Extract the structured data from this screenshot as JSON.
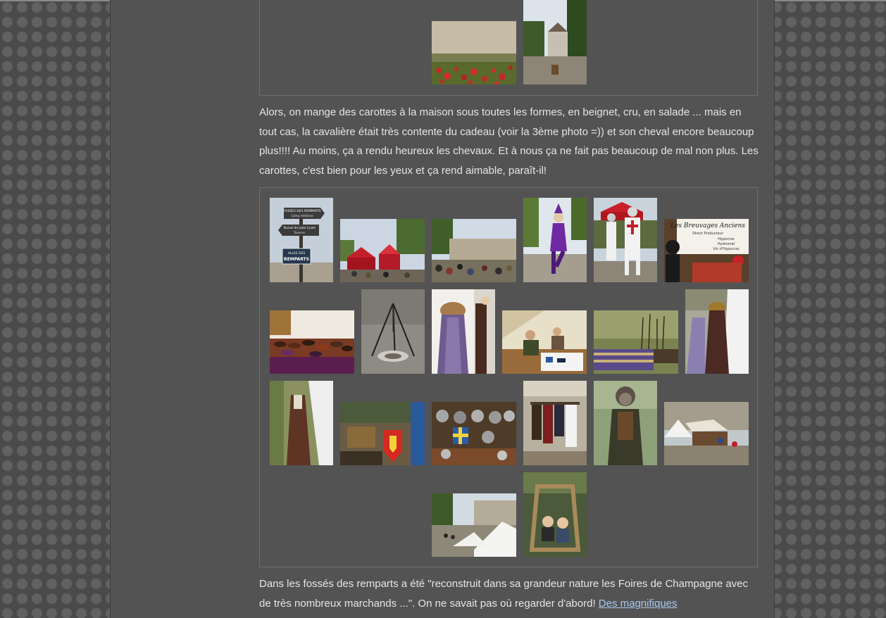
{
  "paragraphs": {
    "p1": "Alors, on mange des carottes à la maison sous toutes les formes, en beignet, cru, en salade ... mais en tout cas, la cavalière était très contente du cadeau (voir la 3ème photo =)) et son cheval encore beaucoup plus!!!! Au moins, ça a rendu heureux les chevaux. Et à nous ça ne fait pas beaucoup de mal non plus. Les carottes, c'est bien pour les yeux et ça rend aimable, paraît-il!",
    "p2_text": "Dans les fossés des remparts a été \"reconstruit dans sa grandeur nature les Foires de Champagne avec de très nombreux marchands ...\". On ne savait pas où regarder d'abord! ",
    "p2_link": "Des magnifiques"
  },
  "signs": {
    "fosses": "FOSSES DES REMPARTS",
    "fosses_sub": "Camp médiéval",
    "tournoi": "Tournoi de joute à pied",
    "taverne": "Taverne",
    "allee": "ALLEE DES",
    "remparts": "REMPARTS",
    "breuvages": "Les Breuvages Anciens",
    "breuvages_sub": "Direct Producteur",
    "breuvages_l1": "Hypocras",
    "breuvages_l2": "Hydromel",
    "breuvages_l3": "Vin d'Hypocras"
  },
  "colors": {
    "background": "#4a4a4a",
    "column": "#535353",
    "text": "#e6e6e6",
    "link": "#a9c9ef",
    "gallery_border": "#6e6e6e"
  },
  "thumbnails": {
    "top": [
      "poppies-rampart-wall-photo",
      "castle-gate-path-photo"
    ],
    "main": [
      "signpost-fosses-remparts-photo",
      "red-tents-crowd-photo",
      "rampart-crowd-photo",
      "jester-purple-photo",
      "templar-knight-photo",
      "breuvages-stall-photo",
      "shoe-stall-photo",
      "tripod-campfire-photo",
      "fur-dress-mannequin-photo",
      "craftsman-tent-photo",
      "weapons-rack-photo",
      "white-dress-mannequin-photo",
      "brown-dress-mannequin-photo",
      "shields-armory-photo",
      "helmets-stall-photo",
      "clothes-stall-photo",
      "costumed-man-photo",
      "white-tents-photo",
      "tents-rampart-path-photo",
      "wooden-frame-visitors-photo"
    ]
  }
}
